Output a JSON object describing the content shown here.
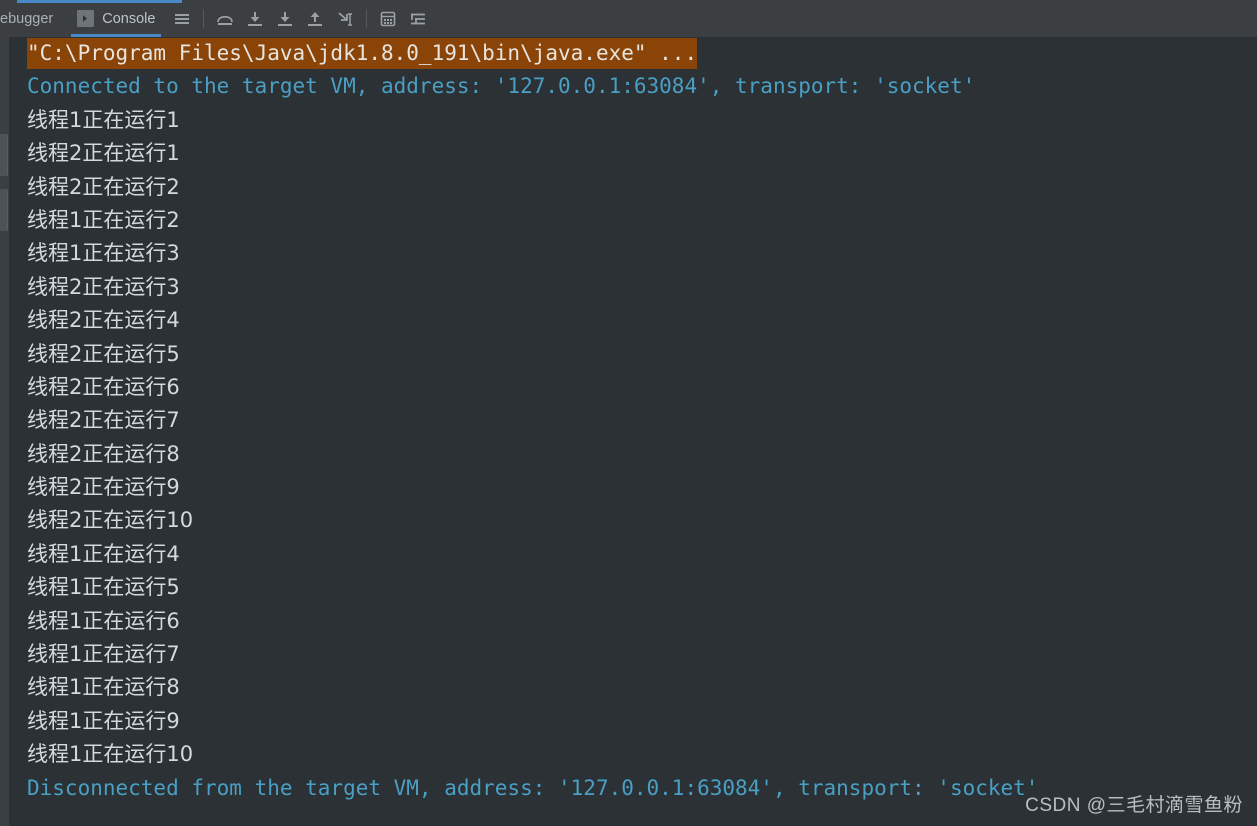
{
  "toolbar": {
    "tabs": [
      {
        "label": "ebugger",
        "active": false,
        "icon": ""
      },
      {
        "label": "Console",
        "active": true,
        "icon": "console-icon",
        "badge": "❯"
      }
    ],
    "icons": [
      {
        "name": "soft-wrap-icon",
        "glyph": "hamburger"
      },
      {
        "name": "step-over-icon",
        "glyph": "step-over"
      },
      {
        "name": "step-into-icon",
        "glyph": "step-into"
      },
      {
        "name": "force-step-into-icon",
        "glyph": "force-step-into"
      },
      {
        "name": "step-out-icon",
        "glyph": "step-out"
      },
      {
        "name": "run-to-cursor-icon",
        "glyph": "run-to-cursor"
      },
      {
        "name": "evaluate-expression-icon",
        "glyph": "calculator"
      },
      {
        "name": "print-settings-icon",
        "glyph": "settings-lines"
      }
    ]
  },
  "console": {
    "lines": [
      {
        "kind": "cmd",
        "text": "\"C:\\Program Files\\Java\\jdk1.8.0_191\\bin\\java.exe\" ..."
      },
      {
        "kind": "sys",
        "text": "Connected to the target VM, address: '127.0.0.1:63084', transport: 'socket'"
      },
      {
        "kind": "out",
        "text": "线程1正在运行1"
      },
      {
        "kind": "out",
        "text": "线程2正在运行1"
      },
      {
        "kind": "out",
        "text": "线程2正在运行2"
      },
      {
        "kind": "out",
        "text": "线程1正在运行2"
      },
      {
        "kind": "out",
        "text": "线程1正在运行3"
      },
      {
        "kind": "out",
        "text": "线程2正在运行3"
      },
      {
        "kind": "out",
        "text": "线程2正在运行4"
      },
      {
        "kind": "out",
        "text": "线程2正在运行5"
      },
      {
        "kind": "out",
        "text": "线程2正在运行6"
      },
      {
        "kind": "out",
        "text": "线程2正在运行7"
      },
      {
        "kind": "out",
        "text": "线程2正在运行8"
      },
      {
        "kind": "out",
        "text": "线程2正在运行9"
      },
      {
        "kind": "out",
        "text": "线程2正在运行10"
      },
      {
        "kind": "out",
        "text": "线程1正在运行4"
      },
      {
        "kind": "out",
        "text": "线程1正在运行5"
      },
      {
        "kind": "out",
        "text": "线程1正在运行6"
      },
      {
        "kind": "out",
        "text": "线程1正在运行7"
      },
      {
        "kind": "out",
        "text": "线程1正在运行8"
      },
      {
        "kind": "out",
        "text": "线程1正在运行9"
      },
      {
        "kind": "out",
        "text": "线程1正在运行10"
      },
      {
        "kind": "sys",
        "text": "Disconnected from the target VM, address: '127.0.0.1:63084', transport: 'socket'"
      }
    ]
  },
  "watermark": {
    "text": "CSDN @三毛村滴雪鱼粉"
  },
  "colors": {
    "background": "#2b3134",
    "toolbar": "#3c3f41",
    "accent": "#4a88c7",
    "system_text": "#4a9fc4",
    "output_text": "#d4d9dd",
    "command_highlight": "#8a4407"
  }
}
